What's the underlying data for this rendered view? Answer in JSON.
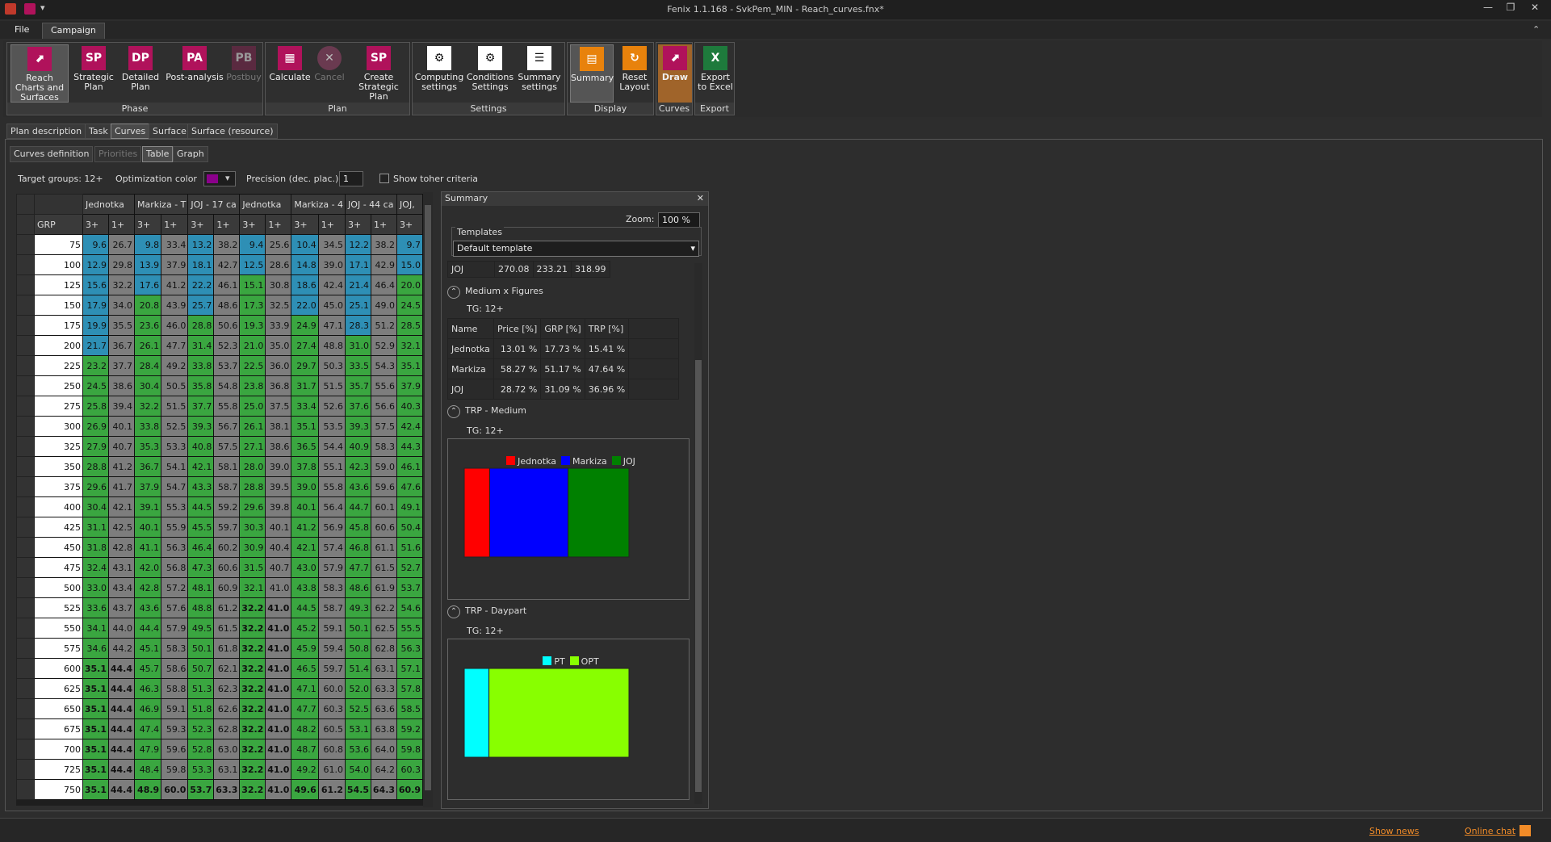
{
  "app": {
    "title": "Fenix 1.1.168 - SvkPem_MIN - Reach_curves.fnx*"
  },
  "menu": {
    "file": "File",
    "campaign": "Campaign"
  },
  "ribbon": {
    "phase": {
      "label": "Phase",
      "reach": "Reach Charts and Surfaces",
      "sp": "Strategic Plan",
      "dp": "Detailed Plan",
      "pa": "Post-analysis",
      "pb": "Postbuy",
      "sp_ico": "SP",
      "dp_ico": "DP",
      "pa_ico": "PA",
      "pb_ico": "PB"
    },
    "plan": {
      "label": "Plan",
      "calculate": "Calculate",
      "cancel": "Cancel",
      "create": "Create Strategic Plan",
      "create_ico": "SP"
    },
    "settings": {
      "label": "Settings",
      "computing": "Computing settings",
      "conditions": "Conditions Settings",
      "summary": "Summary settings"
    },
    "display": {
      "label": "Display",
      "summary": "Summary",
      "reset": "Reset Layout"
    },
    "curves": {
      "label": "Curves",
      "draw": "Draw"
    },
    "export": {
      "label": "Export",
      "excel": "Export to Excel"
    }
  },
  "tabs_main": [
    "Plan description",
    "Task",
    "Curves",
    "Surface",
    "Surface (resource)"
  ],
  "tabs_sub": [
    "Curves definition",
    "Priorities",
    "Table",
    "Graph"
  ],
  "toolbar": {
    "target": "Target groups: 12+",
    "optcolor": "Optimization color",
    "precision_label": "Precision (dec. plac.):",
    "precision": "1",
    "show_toher": "Show toher criteria"
  },
  "grid": {
    "headers": [
      "Jednotka",
      "Markiza - T",
      "JOJ - 17 ca",
      "Jednotka",
      "Markiza - 4",
      "JOJ - 44 ca",
      "JOJ,"
    ],
    "grp_label": "GRP",
    "sub": [
      "3+",
      "1+",
      "3+",
      "1+",
      "3+",
      "1+",
      "3+",
      "1+",
      "3+",
      "1+",
      "3+",
      "1+",
      "3+"
    ],
    "rows": [
      [
        "75",
        "9.6",
        "26.7",
        "9.8",
        "33.4",
        "13.2",
        "38.2",
        "9.4",
        "25.6",
        "10.4",
        "34.5",
        "12.2",
        "38.2",
        "9.7"
      ],
      [
        "100",
        "12.9",
        "29.8",
        "13.9",
        "37.9",
        "18.1",
        "42.7",
        "12.5",
        "28.6",
        "14.8",
        "39.0",
        "17.1",
        "42.9",
        "15.0"
      ],
      [
        "125",
        "15.6",
        "32.2",
        "17.6",
        "41.2",
        "22.2",
        "46.1",
        "15.1",
        "30.8",
        "18.6",
        "42.4",
        "21.4",
        "46.4",
        "20.0"
      ],
      [
        "150",
        "17.9",
        "34.0",
        "20.8",
        "43.9",
        "25.7",
        "48.6",
        "17.3",
        "32.5",
        "22.0",
        "45.0",
        "25.1",
        "49.0",
        "24.5"
      ],
      [
        "175",
        "19.9",
        "35.5",
        "23.6",
        "46.0",
        "28.8",
        "50.6",
        "19.3",
        "33.9",
        "24.9",
        "47.1",
        "28.3",
        "51.2",
        "28.5"
      ],
      [
        "200",
        "21.7",
        "36.7",
        "26.1",
        "47.7",
        "31.4",
        "52.3",
        "21.0",
        "35.0",
        "27.4",
        "48.8",
        "31.0",
        "52.9",
        "32.1"
      ],
      [
        "225",
        "23.2",
        "37.7",
        "28.4",
        "49.2",
        "33.8",
        "53.7",
        "22.5",
        "36.0",
        "29.7",
        "50.3",
        "33.5",
        "54.3",
        "35.1"
      ],
      [
        "250",
        "24.5",
        "38.6",
        "30.4",
        "50.5",
        "35.8",
        "54.8",
        "23.8",
        "36.8",
        "31.7",
        "51.5",
        "35.7",
        "55.6",
        "37.9"
      ],
      [
        "275",
        "25.8",
        "39.4",
        "32.2",
        "51.5",
        "37.7",
        "55.8",
        "25.0",
        "37.5",
        "33.4",
        "52.6",
        "37.6",
        "56.6",
        "40.3"
      ],
      [
        "300",
        "26.9",
        "40.1",
        "33.8",
        "52.5",
        "39.3",
        "56.7",
        "26.1",
        "38.1",
        "35.1",
        "53.5",
        "39.3",
        "57.5",
        "42.4"
      ],
      [
        "325",
        "27.9",
        "40.7",
        "35.3",
        "53.3",
        "40.8",
        "57.5",
        "27.1",
        "38.6",
        "36.5",
        "54.4",
        "40.9",
        "58.3",
        "44.3"
      ],
      [
        "350",
        "28.8",
        "41.2",
        "36.7",
        "54.1",
        "42.1",
        "58.1",
        "28.0",
        "39.0",
        "37.8",
        "55.1",
        "42.3",
        "59.0",
        "46.1"
      ],
      [
        "375",
        "29.6",
        "41.7",
        "37.9",
        "54.7",
        "43.3",
        "58.7",
        "28.8",
        "39.5",
        "39.0",
        "55.8",
        "43.6",
        "59.6",
        "47.6"
      ],
      [
        "400",
        "30.4",
        "42.1",
        "39.1",
        "55.3",
        "44.5",
        "59.2",
        "29.6",
        "39.8",
        "40.1",
        "56.4",
        "44.7",
        "60.1",
        "49.1"
      ],
      [
        "425",
        "31.1",
        "42.5",
        "40.1",
        "55.9",
        "45.5",
        "59.7",
        "30.3",
        "40.1",
        "41.2",
        "56.9",
        "45.8",
        "60.6",
        "50.4"
      ],
      [
        "450",
        "31.8",
        "42.8",
        "41.1",
        "56.3",
        "46.4",
        "60.2",
        "30.9",
        "40.4",
        "42.1",
        "57.4",
        "46.8",
        "61.1",
        "51.6"
      ],
      [
        "475",
        "32.4",
        "43.1",
        "42.0",
        "56.8",
        "47.3",
        "60.6",
        "31.5",
        "40.7",
        "43.0",
        "57.9",
        "47.7",
        "61.5",
        "52.7"
      ],
      [
        "500",
        "33.0",
        "43.4",
        "42.8",
        "57.2",
        "48.1",
        "60.9",
        "32.1",
        "41.0",
        "43.8",
        "58.3",
        "48.6",
        "61.9",
        "53.7"
      ],
      [
        "525",
        "33.6",
        "43.7",
        "43.6",
        "57.6",
        "48.8",
        "61.2",
        "32.2",
        "41.0",
        "44.5",
        "58.7",
        "49.3",
        "62.2",
        "54.6"
      ],
      [
        "550",
        "34.1",
        "44.0",
        "44.4",
        "57.9",
        "49.5",
        "61.5",
        "32.2",
        "41.0",
        "45.2",
        "59.1",
        "50.1",
        "62.5",
        "55.5"
      ],
      [
        "575",
        "34.6",
        "44.2",
        "45.1",
        "58.3",
        "50.1",
        "61.8",
        "32.2",
        "41.0",
        "45.9",
        "59.4",
        "50.8",
        "62.8",
        "56.3"
      ],
      [
        "600",
        "35.1",
        "44.4",
        "45.7",
        "58.6",
        "50.7",
        "62.1",
        "32.2",
        "41.0",
        "46.5",
        "59.7",
        "51.4",
        "63.1",
        "57.1"
      ],
      [
        "625",
        "35.1",
        "44.4",
        "46.3",
        "58.8",
        "51.3",
        "62.3",
        "32.2",
        "41.0",
        "47.1",
        "60.0",
        "52.0",
        "63.3",
        "57.8"
      ],
      [
        "650",
        "35.1",
        "44.4",
        "46.9",
        "59.1",
        "51.8",
        "62.6",
        "32.2",
        "41.0",
        "47.7",
        "60.3",
        "52.5",
        "63.6",
        "58.5"
      ],
      [
        "675",
        "35.1",
        "44.4",
        "47.4",
        "59.3",
        "52.3",
        "62.8",
        "32.2",
        "41.0",
        "48.2",
        "60.5",
        "53.1",
        "63.8",
        "59.2"
      ],
      [
        "700",
        "35.1",
        "44.4",
        "47.9",
        "59.6",
        "52.8",
        "63.0",
        "32.2",
        "41.0",
        "48.7",
        "60.8",
        "53.6",
        "64.0",
        "59.8"
      ],
      [
        "725",
        "35.1",
        "44.4",
        "48.4",
        "59.8",
        "53.3",
        "63.1",
        "32.2",
        "41.0",
        "49.2",
        "61.0",
        "54.0",
        "64.2",
        "60.3"
      ],
      [
        "750",
        "35.1",
        "44.4",
        "48.9",
        "60.0",
        "53.7",
        "63.3",
        "32.2",
        "41.0",
        "49.6",
        "61.2",
        "54.5",
        "64.3",
        "60.9"
      ]
    ]
  },
  "summary": {
    "title": "Summary",
    "zoom_label": "Zoom:",
    "zoom": "100 %",
    "templates_label": "Templates",
    "template": "Default template",
    "top_row": [
      "JOJ",
      "270.08",
      "233.21",
      "318.99"
    ],
    "medium_figures": {
      "title": "Medium x Figures",
      "tg": "TG: 12+",
      "head": [
        "Name",
        "Price [%]",
        "GRP [%]",
        "TRP [%]"
      ],
      "rows": [
        [
          "Jednotka",
          "13.01 %",
          "17.73 %",
          "15.41 %"
        ],
        [
          "Markiza",
          "58.27 %",
          "51.17 %",
          "47.64 %"
        ],
        [
          "JOJ",
          "28.72 %",
          "31.09 %",
          "36.96 %"
        ]
      ]
    },
    "trp_medium": {
      "title": "TRP - Medium",
      "tg": "TG: 12+",
      "legend": [
        {
          "name": "Jednotka",
          "color": "#ff0000"
        },
        {
          "name": "Markiza",
          "color": "#0000ff"
        },
        {
          "name": "JOJ",
          "color": "#008000"
        }
      ]
    },
    "trp_daypart": {
      "title": "TRP - Daypart",
      "tg": "TG: 12+",
      "legend": [
        {
          "name": "PT",
          "color": "#00ffff"
        },
        {
          "name": "OPT",
          "color": "#88ff00"
        }
      ]
    }
  },
  "chart_data": [
    {
      "type": "bar",
      "title": "TRP - Medium",
      "categories": [
        "Jednotka",
        "Markiza",
        "JOJ"
      ],
      "values": [
        15.41,
        47.64,
        36.96
      ]
    },
    {
      "type": "bar",
      "title": "TRP - Daypart",
      "categories": [
        "PT",
        "OPT"
      ],
      "values": [
        15,
        85
      ]
    }
  ],
  "status": {
    "news": "Show news",
    "chat": "Online chat"
  }
}
